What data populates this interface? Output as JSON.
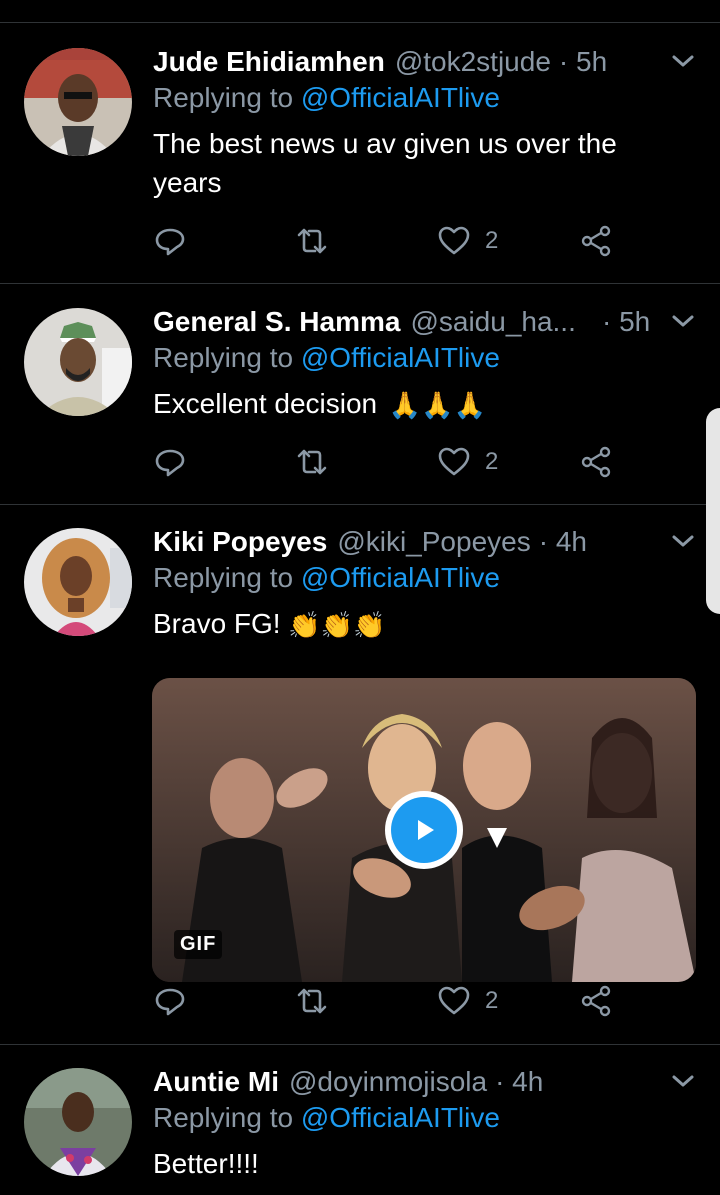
{
  "tweets": [
    {
      "name": "Jude Ehidiamhen",
      "handle": "@tok2stjude",
      "time": "· 5h",
      "replying_prefix": "Replying to ",
      "replying_to": "@OfficialAITlive",
      "text": "The best news u av given us over the years",
      "likes": "2"
    },
    {
      "name": "General S. Hamma",
      "handle": "@saidu_ha...",
      "time": "· 5h",
      "replying_prefix": "Replying to ",
      "replying_to": "@OfficialAITlive",
      "text": "Excellent decision",
      "emoji": "🙏🙏🙏",
      "likes": "2"
    },
    {
      "name": "Kiki Popeyes",
      "handle": "@kiki_Popeyes",
      "time": "· 4h",
      "replying_prefix": "Replying to ",
      "replying_to": "@OfficialAITlive",
      "text": "Bravo FG!",
      "emoji": "👏👏👏",
      "media_badge": "GIF",
      "likes": "2"
    },
    {
      "name": "Auntie Mi",
      "handle": "@doyinmojisola",
      "time": "· 4h",
      "replying_prefix": "Replying to ",
      "replying_to": "@OfficialAITlive",
      "text": "Better!!!!"
    }
  ],
  "colors": {
    "background": "#000000",
    "secondary_text": "#8b98a5",
    "accent": "#1d9bf0",
    "divider": "#2f3336"
  },
  "icons": [
    "reply-icon",
    "retweet-icon",
    "heart-icon",
    "share-icon",
    "chevron-down-icon",
    "play-icon"
  ]
}
